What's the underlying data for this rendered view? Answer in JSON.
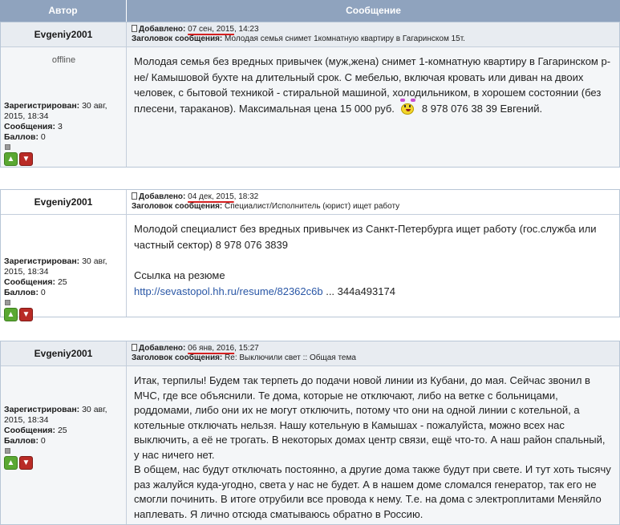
{
  "header": {
    "author_col": "Автор",
    "message_col": "Сообщение"
  },
  "labels": {
    "added": "Добавлено:",
    "subject": "Заголовок сообщения:",
    "registered": "Зарегистрирован:",
    "messages": "Сообщения:",
    "points": "Баллов:"
  },
  "posts": [
    {
      "author": "Evgeniy2001",
      "status": "offline",
      "date": "07 сен, 2015",
      "time": ", 14:23",
      "subject": "Молодая семья снимет 1комнатную квартиру в Гагаринском 15т.",
      "registered_line1": "30 авг,",
      "registered_line2": "2015, 18:34",
      "messages": "3",
      "points": "0",
      "text_part1": "Молодая семья без вредных привычек (муж,жена) снимет 1-комнатную квартиру в Гагаринском р-не/ Камышовой бухте на длительный срок. С мебелью, включая кровать или диван на двоих человек, с бытовой техникой - стиральной машиной, холодильником, в хорошем состоянии (без плесени, тараканов). Максимальная цена 15 000 руб.",
      "text_part2": "8 978 076 38 39 Евгений."
    },
    {
      "author": "Evgeniy2001",
      "date": "04 дек, 2015",
      "time": ", 18:32",
      "subject": "Специалист/Исполнитель (юрист) ищет работу",
      "registered_line1": "30 авг,",
      "registered_line2": "2015, 18:34",
      "messages": "25",
      "points": "0",
      "text_line1": "Молодой специалист без вредных привычек из Санкт-Петербурга ищет работу (гос.служба или частный сектор) 8 978 076 3839",
      "resume_label": "Ссылка на резюме",
      "resume_link": "http://sevastopol.hh.ru/resume/82362c6b",
      "resume_rest": " ... 344a493174"
    },
    {
      "author": "Evgeniy2001",
      "date": "06 янв, 2016",
      "time": ", 15:27",
      "subject": "Re: Выключили свет :: Общая тема",
      "registered_line1": "30 авг,",
      "registered_line2": "2015, 18:34",
      "messages": "25",
      "points": "0",
      "text_p1": "Итак, терпилы! Будем так терпеть до подачи новой линии из Кубани, до мая. Сейчас звонил в МЧС, где все объяснили. Те дома, которые не отключают, либо на ветке с больницами, роддомами, либо они их не могут отключить, потому что они на одной линии с котельной, а котельные отключать нельзя. Нашу котельную в Камышах - пожалуйста, можно всех нас выключить, а её не трогать. В некоторых домах центр связи, ещё что-то. А наш район спальный, у нас ничего нет.",
      "text_p2": "В общем, нас будут отключать постоянно, а другие дома также будут при свете. И тут хоть тысячу раз жалуйся куда-угодно, света у нас не будет. А в нашем доме сломался генератор, так его не смогли починить. В итоге отрубили все провода к нему. Т.е. на дома с электроплитами Меняйло наплевать. Я лично отсюда сматываюсь обратно в Россию."
    }
  ],
  "icons": {
    "thumb_up": "thumb-up-icon",
    "thumb_down": "thumb-down-icon",
    "smiley": "smiley-icon",
    "doc": "document-icon"
  },
  "colors": {
    "header_bg": "#8fa3be",
    "row_head_bg": "#e8ecf1",
    "body_bg": "#f4f6f8",
    "link": "#2a57a6",
    "date_underline": "#d42020"
  }
}
